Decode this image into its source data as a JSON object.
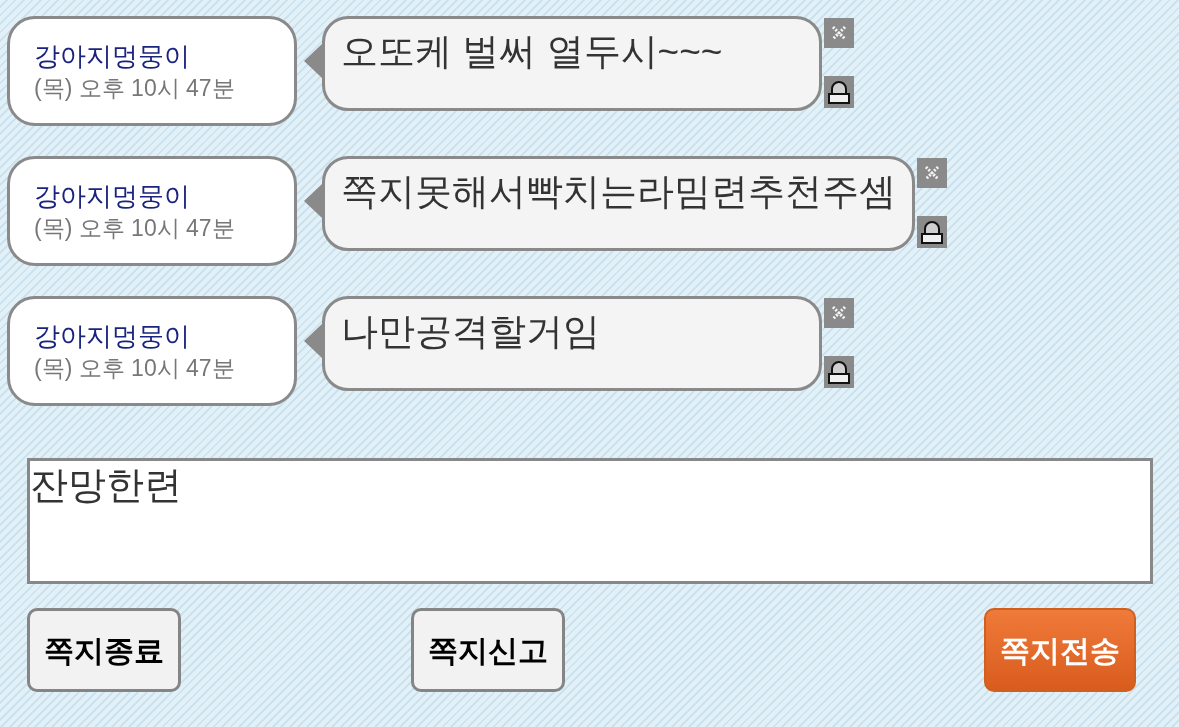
{
  "messages": [
    {
      "sender": "강아지멍뭉이",
      "time": "(목) 오후 10시 47분",
      "text": "오또케 벌써 열두시~~~"
    },
    {
      "sender": "강아지멍뭉이",
      "time": "(목) 오후 10시 47분",
      "text": "쪽지못해서빡치는라밈련추천주셈"
    },
    {
      "sender": "강아지멍뭉이",
      "time": "(목) 오후 10시 47분",
      "text": "나만공격할거임"
    }
  ],
  "compose": {
    "value": "잔망한련"
  },
  "buttons": [
    {
      "label": "쪽지종료",
      "kind": "secondary"
    },
    {
      "label": "쪽지신고",
      "kind": "secondary"
    },
    {
      "label": "쪽지전송",
      "kind": "primary"
    }
  ]
}
